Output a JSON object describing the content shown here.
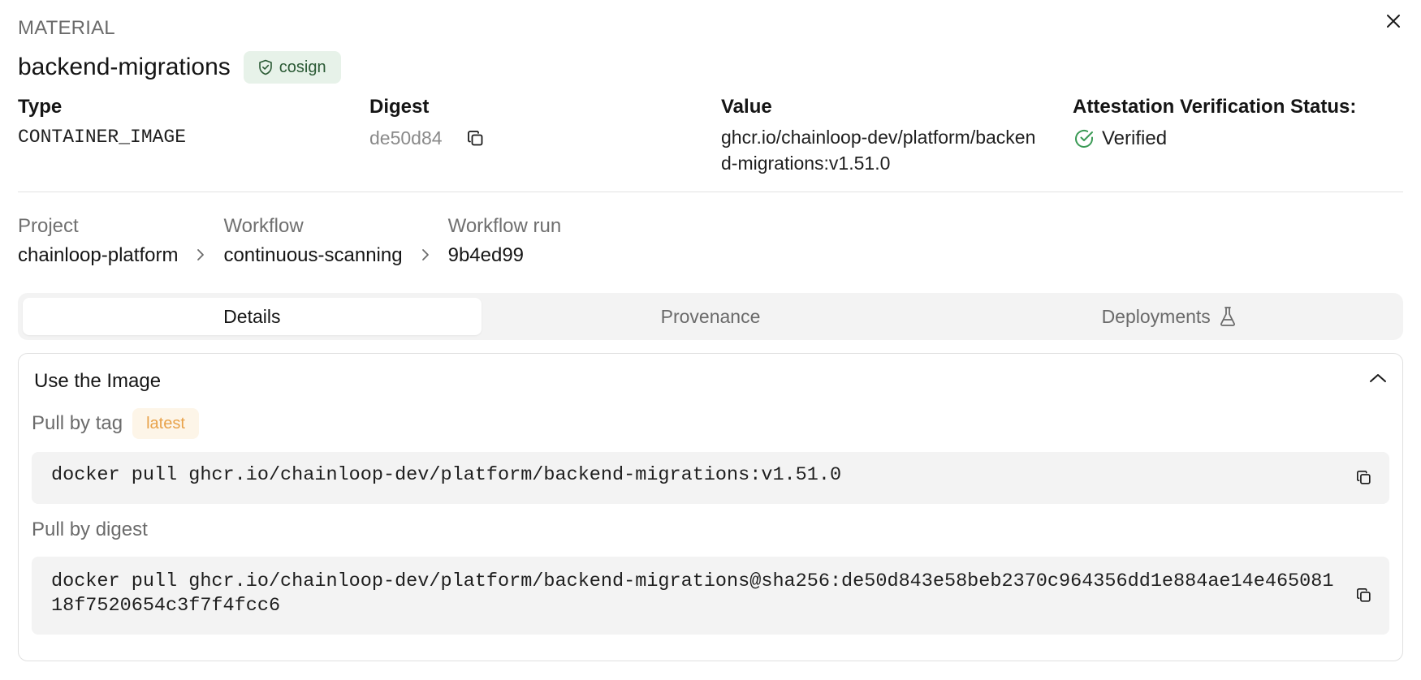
{
  "header": {
    "kind": "MATERIAL",
    "name": "backend-migrations",
    "signer_badge": "cosign"
  },
  "meta": {
    "type": {
      "label": "Type",
      "value": "CONTAINER_IMAGE"
    },
    "digest": {
      "label": "Digest",
      "value": "de50d84"
    },
    "value": {
      "label": "Value",
      "value": "ghcr.io/chainloop-dev/platform/backend-migrations:v1.51.0"
    },
    "status": {
      "label": "Attestation Verification Status:",
      "value": "Verified"
    }
  },
  "breadcrumb": {
    "project": {
      "label": "Project",
      "value": "chainloop-platform"
    },
    "workflow": {
      "label": "Workflow",
      "value": "continuous-scanning"
    },
    "run": {
      "label": "Workflow run",
      "value": "9b4ed99"
    }
  },
  "tabs": [
    {
      "label": "Details",
      "active": true
    },
    {
      "label": "Provenance",
      "active": false
    },
    {
      "label": "Deployments",
      "active": false
    }
  ],
  "use_image": {
    "title": "Use the Image",
    "pull_by_tag": {
      "label": "Pull by tag",
      "tag": "latest",
      "command": "docker pull ghcr.io/chainloop-dev/platform/backend-migrations:v1.51.0"
    },
    "pull_by_digest": {
      "label": "Pull by digest",
      "command": "docker pull ghcr.io/chainloop-dev/platform/backend-migrations@sha256:de50d843e58beb2370c964356dd1e884ae14e46508118f7520654c3f7f4fcc6"
    }
  },
  "colors": {
    "verified": "#3a9a55",
    "cosign_bg": "#e7f2e9",
    "tag_bg": "#fdf5e8",
    "tag_text": "#e8a24a"
  },
  "icons": {
    "close": "close-icon",
    "shield": "shield-check-icon",
    "copy": "copy-icon",
    "check": "check-circle-icon",
    "chevron_right": "chevron-right-icon",
    "chevron_up": "chevron-up-icon",
    "flask": "flask-icon"
  }
}
